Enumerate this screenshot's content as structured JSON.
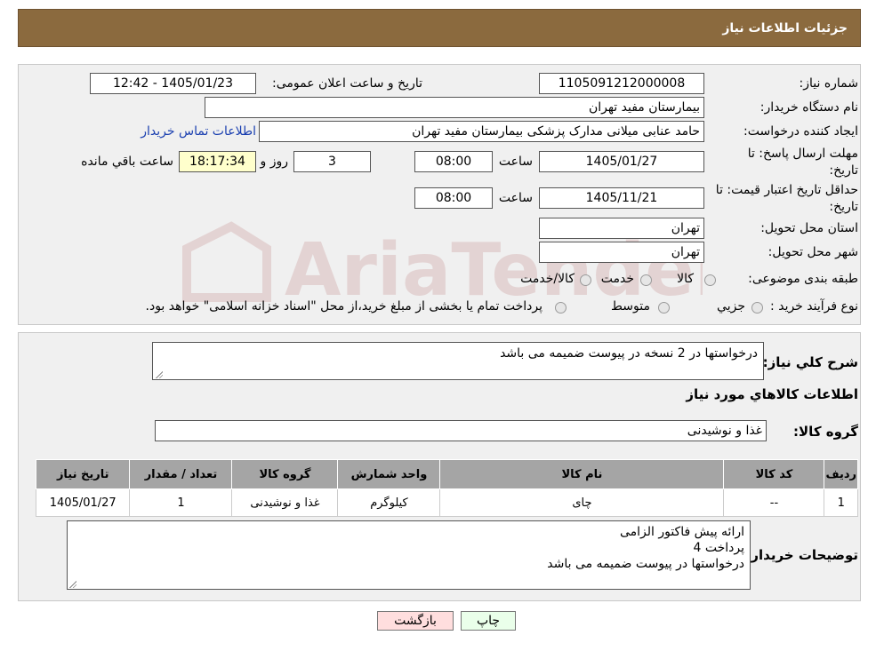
{
  "header": {
    "title": "جزئیات اطلاعات نیاز"
  },
  "form": {
    "need_number_label": "شماره نیاز:",
    "need_number": "1105091212000008",
    "announce_label": "تاریخ و ساعت اعلان عمومی:",
    "announce_value": "1405/01/23 - 12:42",
    "buyer_org_label": "نام دستگاه خریدار:",
    "buyer_org": "بیمارستان مفید تهران",
    "requester_label": "ایجاد کننده درخواست:",
    "requester": "حامد عنابی میلانی مدارک پزشکی بیمارستان مفید تهران",
    "contact_link": "اطلاعات تماس خریدار",
    "reply_deadline_label_1": "مهلت ارسال پاسخ: تا",
    "reply_deadline_label_2": "تاریخ:",
    "reply_date": "1405/01/27",
    "time_label": "ساعت",
    "reply_time": "08:00",
    "days": "3",
    "days_label": "روز و",
    "remaining_time": "18:17:34",
    "remaining_label": "ساعت باقي مانده",
    "price_validity_label_1": "حداقل تاریخ اعتبار قیمت: تا",
    "price_validity_label_2": "تاریخ:",
    "price_validity_date": "1405/11/21",
    "price_validity_time": "08:00",
    "province_label": "استان محل تحویل:",
    "province": "تهران",
    "city_label": "شهر محل تحویل:",
    "city": "تهران",
    "category_label": "طبقه بندی موضوعی:",
    "category_options": [
      "کالا",
      "خدمت",
      "کالا/خدمت"
    ],
    "process_label": "نوع فرآیند خرید :",
    "process_options": [
      "جزیي",
      "متوسط"
    ],
    "process_note": "پرداخت تمام یا بخشی از مبلغ خرید،از محل \"اسناد خزانه اسلامی\" خواهد بود."
  },
  "description": {
    "label": "شرح کلي نياز:",
    "text": "درخواستها در 2 نسخه در پیوست ضمیمه می باشد",
    "items_heading": "اطلاعات کالاهاي مورد نياز",
    "group_label": "گروه کالا:",
    "group_value": "غذا و نوشیدنی"
  },
  "table": {
    "headers": [
      "رديف",
      "کد کالا",
      "نام کالا",
      "واحد شمارش",
      "گروه کالا",
      "تعداد / مقدار",
      "تاریخ نیاز"
    ],
    "rows": [
      [
        "1",
        "--",
        "چای",
        "کیلوگرم",
        "غذا و نوشیدنی",
        "1",
        "1405/01/27"
      ]
    ]
  },
  "buyer_notes": {
    "label": "توضیحات خریدار:",
    "lines": [
      "ارائه پیش فاکتور الزامی",
      "پرداخت 4",
      "درخواستها در پیوست ضمیمه می باشد"
    ]
  },
  "buttons": {
    "print": "چاپ",
    "back": "بازگشت"
  },
  "colors": {
    "header": "#8b6a3e",
    "remaining_bg": "#ffffcc",
    "back_bg": "#ffdede",
    "print_bg": "#eaffea"
  }
}
